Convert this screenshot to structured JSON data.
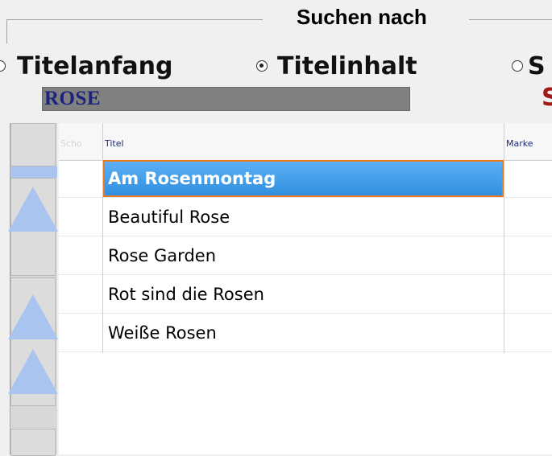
{
  "search_group": {
    "title": "Suchen nach",
    "options": [
      {
        "label": "Titelanfang",
        "selected": false
      },
      {
        "label": "Titelinhalt",
        "selected": true
      },
      {
        "label": "S",
        "selected": false
      }
    ],
    "query": "ROSE",
    "status_fragment": "S"
  },
  "table": {
    "columns": [
      "Scho",
      "Titel",
      "Marke"
    ],
    "rows": [
      {
        "title": "Am Rosenmontag",
        "selected": true
      },
      {
        "title": "Beautiful Rose",
        "selected": false
      },
      {
        "title": "Rose Garden",
        "selected": false
      },
      {
        "title": "Rot sind die Rosen",
        "selected": false
      },
      {
        "title": "Weiße Rosen",
        "selected": false
      }
    ]
  },
  "colors": {
    "selection": "#2f8fe0",
    "selection_border": "#e87a22",
    "scroll_arrows": "#a9c4ef",
    "search_bg": "#808080",
    "search_text": "#1a237e"
  },
  "icons": [
    "radio-unchecked-icon",
    "radio-checked-icon",
    "scroll-up-arrow-icon"
  ]
}
